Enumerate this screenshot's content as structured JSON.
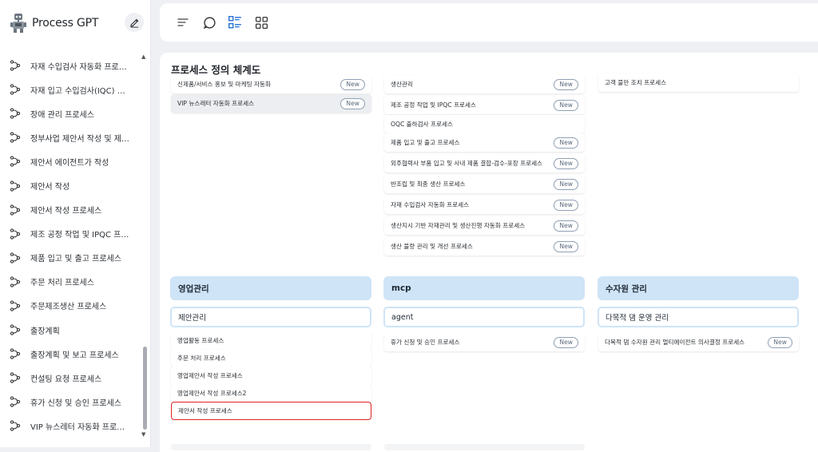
{
  "app": {
    "title": "Process GPT"
  },
  "sidebar": {
    "items": [
      {
        "label": "자재 수입검사 자동화 프로세스"
      },
      {
        "label": "자재 입고 수입검사(IQC) 프로세스"
      },
      {
        "label": "장애 관리 프로세스"
      },
      {
        "label": "정부사업 제안서 작성 및 제출 프로세스"
      },
      {
        "label": "제안서 에이전트가 작성"
      },
      {
        "label": "제안서 작성"
      },
      {
        "label": "제안서 작성 프로세스"
      },
      {
        "label": "제조 공정 작업 및 IPQC 프로세스"
      },
      {
        "label": "제품 입고 및 출고 프로세스"
      },
      {
        "label": "주문 처리 프로세스"
      },
      {
        "label": "주문제조생산 프로세스"
      },
      {
        "label": "출장계획"
      },
      {
        "label": "출장계획 및 보고 프로세스"
      },
      {
        "label": "컨설팅 요청 프로세스"
      },
      {
        "label": "휴가 신청 및 승인 프로세스"
      },
      {
        "label": "VIP 뉴스레터 자동화 프로세스"
      }
    ]
  },
  "main": {
    "title": "프로세스 정의 체계도",
    "badge_new": "New",
    "col1_items": [
      {
        "label": "신제품/서비스 홍보 및 마케팅 자동화",
        "new": true
      },
      {
        "label": "VIP 뉴스레터 자동화 프로세스",
        "new": true
      }
    ],
    "col2_items": [
      {
        "label": "생산관리",
        "new": true
      },
      {
        "label": "제조 공정 작업 및 IPQC 프로세스",
        "new": true
      },
      {
        "label": "OQC 출하검사 프로세스",
        "new": false
      },
      {
        "label": "제품 입고 및 출고 프로세스",
        "new": true
      },
      {
        "label": "외주협력사 부품 입고 및 사내 제품 결합-검수-포장 프로세스",
        "new": true
      },
      {
        "label": "반조립 및 최종 생산 프로세스",
        "new": true
      },
      {
        "label": "자재 수입검사 자동화 프로세스",
        "new": true
      },
      {
        "label": "생산지시 기반 자재관리 및 생산진행 자동화 프로세스",
        "new": true
      },
      {
        "label": "생산 불량 관리 및 개선 프로세스",
        "new": true
      }
    ],
    "col3_items": [
      {
        "label": "고객 불만 조치 프로세스",
        "new": false
      }
    ],
    "categories": [
      {
        "title": "영업관리",
        "sub": "제안관리",
        "items": [
          {
            "label": "영업활동 프로세스",
            "new": false
          },
          {
            "label": "주문 처리 프로세스",
            "new": false
          },
          {
            "label": "영업제안서 작성 프로세스",
            "new": false
          },
          {
            "label": "영업제안서 작성 프로세스2",
            "new": false
          },
          {
            "label": "제안서 작성 프로세스",
            "new": false
          }
        ]
      },
      {
        "title": "mcp",
        "sub": "agent",
        "items": [
          {
            "label": "휴가 신청 및 승인 프로세스",
            "new": true
          }
        ]
      },
      {
        "title": "수자원 관리",
        "sub": "다목적 댐 운영 관리",
        "items": [
          {
            "label": "다목적 댐 수자원 관리 멀티에이전트 의사결정 프로세스",
            "new": true
          }
        ]
      }
    ]
  },
  "colors": {
    "accent_blue": "#cfe4f7",
    "highlight_red": "#e02424",
    "badge_border": "#8fa0b3"
  }
}
